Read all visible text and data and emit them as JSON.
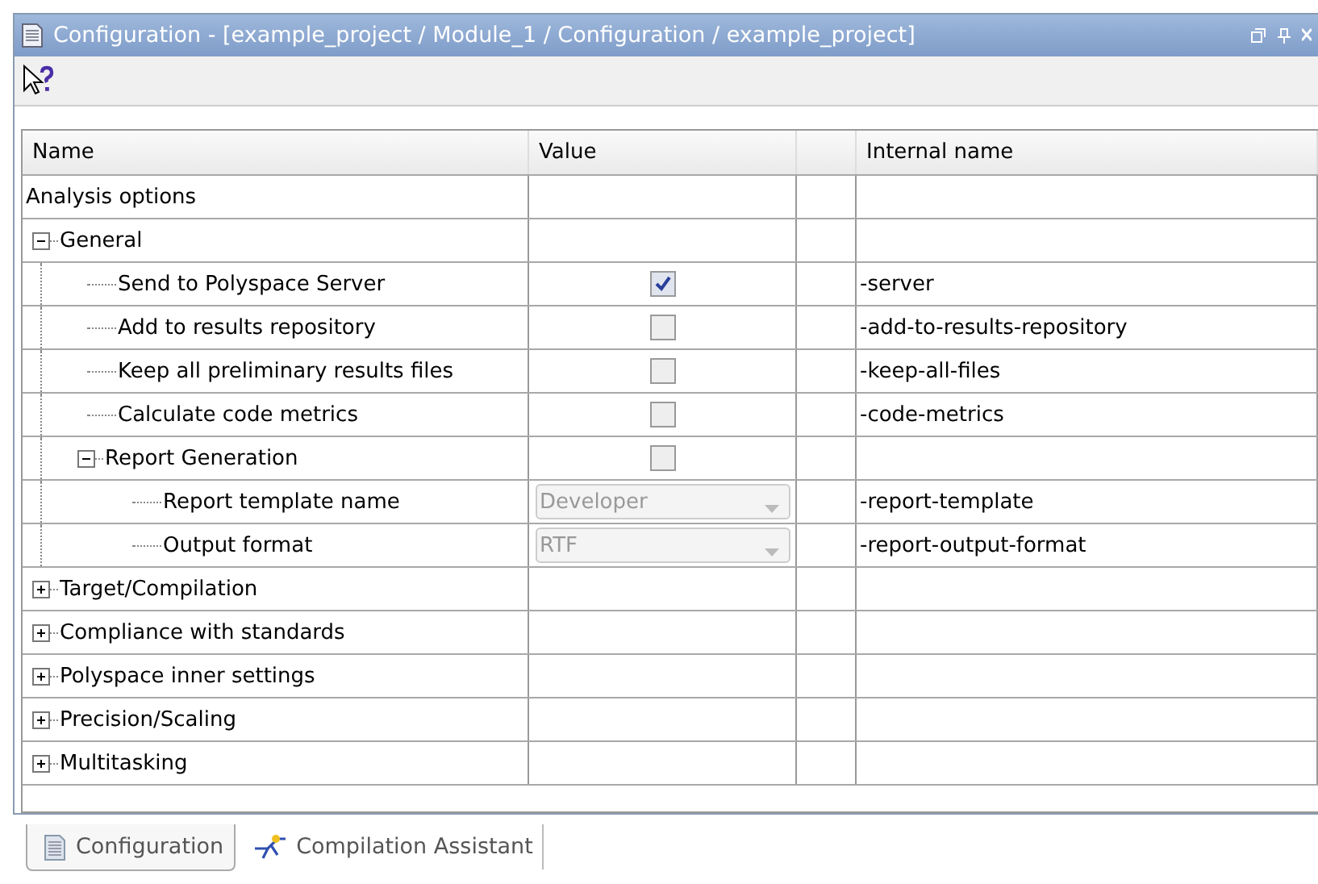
{
  "window": {
    "title": "Configuration - [example_project / Module_1 / Configuration / example_project]"
  },
  "table": {
    "columns": [
      "Name",
      "Value",
      "Internal name"
    ],
    "rows": [
      {
        "name": "Analysis options",
        "children": [
          {
            "name": "General",
            "expanded": true,
            "children": [
              {
                "name": "Send to Polyspace Server",
                "value": {
                  "kind": "checkbox",
                  "checked": true
                },
                "internal": "-server"
              },
              {
                "name": "Add to results repository",
                "value": {
                  "kind": "checkbox",
                  "checked": false
                },
                "internal": "-add-to-results-repository"
              },
              {
                "name": "Keep all preliminary results files",
                "value": {
                  "kind": "checkbox",
                  "checked": false
                },
                "internal": "-keep-all-files"
              },
              {
                "name": "Calculate code metrics",
                "value": {
                  "kind": "checkbox",
                  "checked": false
                },
                "internal": "-code-metrics"
              },
              {
                "name": "Report Generation",
                "expanded": true,
                "value": {
                  "kind": "checkbox",
                  "checked": false
                },
                "children": [
                  {
                    "name": "Report template name",
                    "value": {
                      "kind": "dropdown",
                      "text": "Developer",
                      "disabled": true
                    },
                    "internal": "-report-template"
                  },
                  {
                    "name": "Output format",
                    "value": {
                      "kind": "dropdown",
                      "text": "RTF",
                      "disabled": true
                    },
                    "internal": "-report-output-format"
                  }
                ]
              }
            ]
          },
          {
            "name": "Target/Compilation",
            "expanded": false
          },
          {
            "name": "Compliance with standards",
            "expanded": false
          },
          {
            "name": "Polyspace inner settings",
            "expanded": false
          },
          {
            "name": "Precision/Scaling",
            "expanded": false
          },
          {
            "name": "Multitasking",
            "expanded": false
          }
        ]
      }
    ]
  },
  "bottom_tabs": [
    {
      "label": "Configuration",
      "selected": true
    },
    {
      "label": "Compilation Assistant",
      "selected": false
    }
  ]
}
